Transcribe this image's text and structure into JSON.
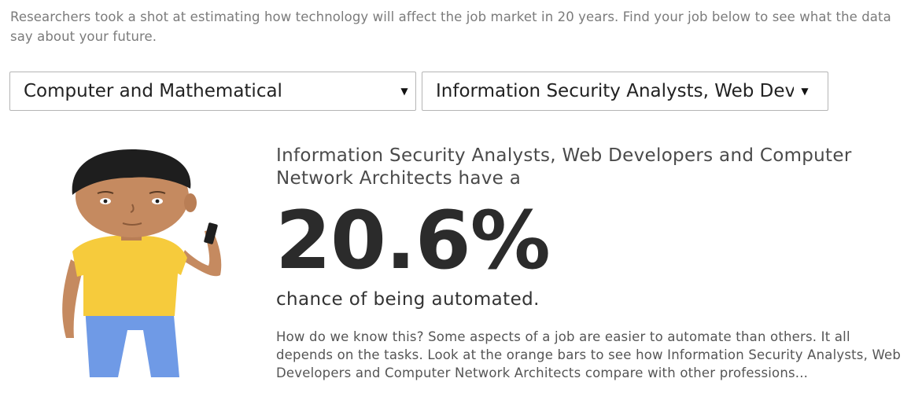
{
  "intro": "Researchers took a shot at estimating how technology will affect the job market in 20 years. Find your job below to see what the data say about your future.",
  "category_select": {
    "value": "Computer and Mathematical",
    "caret": "▼"
  },
  "job_select": {
    "value": "Information Security Analysts, Web Developers and Computer Network Architects",
    "caret": "▼"
  },
  "result": {
    "headline": "Information Security Analysts, Web Developers and Computer Network Architects have a",
    "percent": "20.6%",
    "chance_text": "chance of being automated.",
    "explanation": "How do we know this? Some aspects of a job are easier to automate than others. It all depends on the tasks. Look at the orange bars to see how Information Security Analysts, Web Developers and Computer Network Architects compare with other professions..."
  },
  "colors": {
    "shirt": "#f6cb3c",
    "pants": "#6f9ae6",
    "skin": "#c58a60",
    "hair": "#1e1e1e"
  }
}
